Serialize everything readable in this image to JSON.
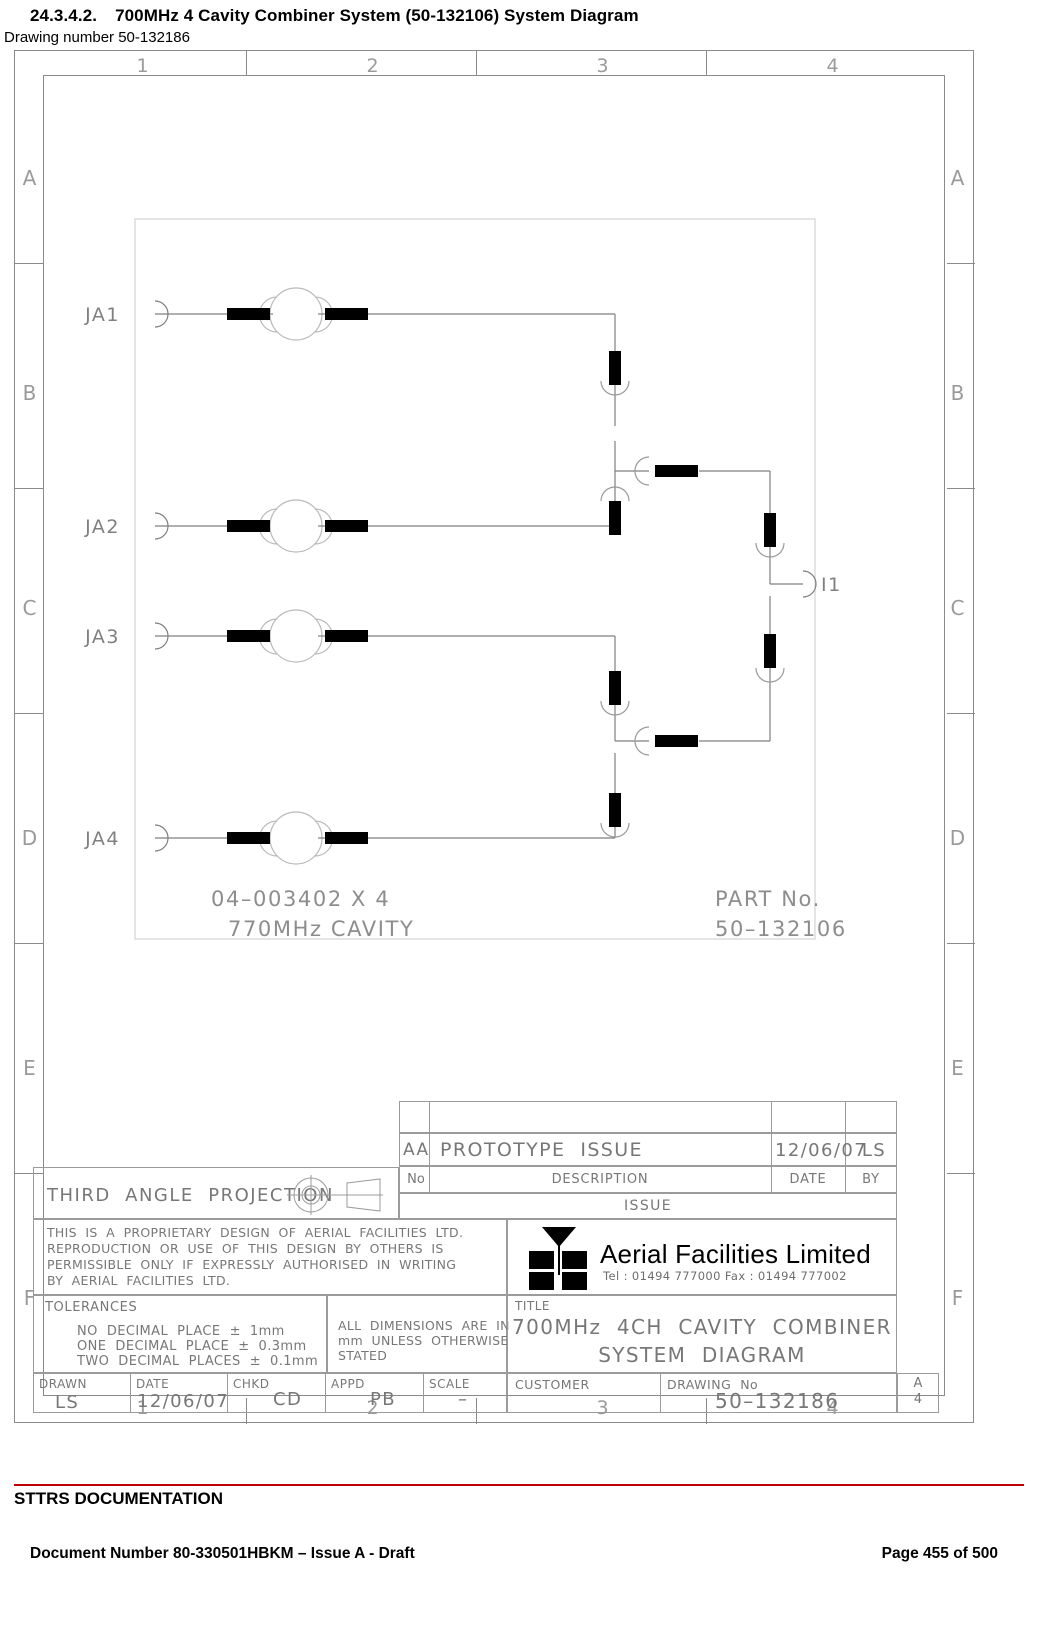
{
  "heading": {
    "number": "24.3.4.2.",
    "title": "700MHz 4 Cavity Combiner System (50-132106) System Diagram",
    "subtitle": "Drawing number 50-132186"
  },
  "sheet": {
    "zones_columns": [
      "1",
      "2",
      "3",
      "4"
    ],
    "zones_rows": [
      "A",
      "B",
      "C",
      "D",
      "E",
      "F"
    ]
  },
  "schematic": {
    "input_ports": [
      "JA1",
      "JA2",
      "JA3",
      "JA4"
    ],
    "output_port": "I1",
    "note_line1": "04-003402 X 4",
    "note_line2": "770MHz CAVITY",
    "part_label": "PART No.",
    "part_number": "50-132106"
  },
  "revision_table": {
    "headers": {
      "no": "No",
      "description": "DESCRIPTION",
      "date": "DATE",
      "by": "BY"
    },
    "section_label": "ISSUE",
    "rows": [
      {
        "no": "AA",
        "description": "PROTOTYPE  ISSUE",
        "date": "12/06/07",
        "by": "LS"
      }
    ]
  },
  "projection": {
    "label": "THIRD  ANGLE  PROJECTION"
  },
  "proprietary_note": {
    "line1": "THIS  IS  A  PROPRIETARY  DESIGN  OF  AERIAL  FACILITIES  LTD.",
    "line2": "REPRODUCTION  OR  USE  OF  THIS  DESIGN  BY  OTHERS  IS",
    "line3": "PERMISSIBLE  ONLY  IF  EXPRESSLY  AUTHORISED  IN  WRITING",
    "line4": "BY  AERIAL  FACILITIES  LTD."
  },
  "tolerances": {
    "heading": "TOLERANCES",
    "line1": "NO  DECIMAL  PLACE  ±  1mm",
    "line2": "ONE  DECIMAL  PLACE  ±  0.3mm",
    "line3": "TWO  DECIMAL  PLACES  ±  0.1mm"
  },
  "dimensions_note": {
    "line1": "ALL  DIMENSIONS  ARE  IN",
    "line2": "mm  UNLESS  OTHERWISE",
    "line3": "STATED"
  },
  "signoff": {
    "drawn_label": "DRAWN",
    "drawn_value": "LS",
    "date_label": "DATE",
    "date_value": "12/06/07",
    "chkd_label": "CHKD",
    "chkd_value": "CD",
    "appd_label": "APPD",
    "appd_value": "PB",
    "scale_label": "SCALE",
    "scale_value": "–"
  },
  "company": {
    "name": "Aerial Facilities Limited",
    "contact": "Tel : 01494 777000 Fax : 01494 777002"
  },
  "title_block": {
    "title_label": "TITLE",
    "title_line1": "700MHz  4CH  CAVITY  COMBINER",
    "title_line2": "SYSTEM  DIAGRAM",
    "customer_label": "CUSTOMER",
    "customer_value": "",
    "drawing_no_label": "DRAWING  No",
    "drawing_no_value": "50–132186",
    "sheet_size_line1": "A",
    "sheet_size_line2": "4"
  },
  "footer": {
    "org": "STTRS DOCUMENTATION",
    "document": "Document Number 80-330501HBKM – Issue A - Draft",
    "page": "Page 455 of 500",
    "rule_color": "#c00000"
  }
}
